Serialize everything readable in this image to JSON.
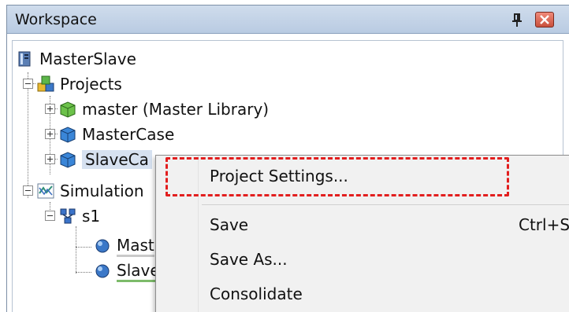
{
  "panel": {
    "title": "Workspace"
  },
  "tree": {
    "root": "MasterSlave",
    "projects": "Projects",
    "master": "master (Master Library)",
    "mastercase": "MasterCase",
    "slavecase": "SlaveCa",
    "simulation": "Simulation",
    "s1": "s1",
    "mast": "Mast",
    "slav": "Slave"
  },
  "context_menu": {
    "project_settings": "Project Settings...",
    "save": "Save",
    "save_shortcut": "Ctrl+S",
    "save_as": "Save As...",
    "consolidate": "Consolidate"
  },
  "colors": {
    "highlight_border": "#e21e1e",
    "title_bar": "#c4d4e8",
    "selection": "#d6e1f0"
  }
}
